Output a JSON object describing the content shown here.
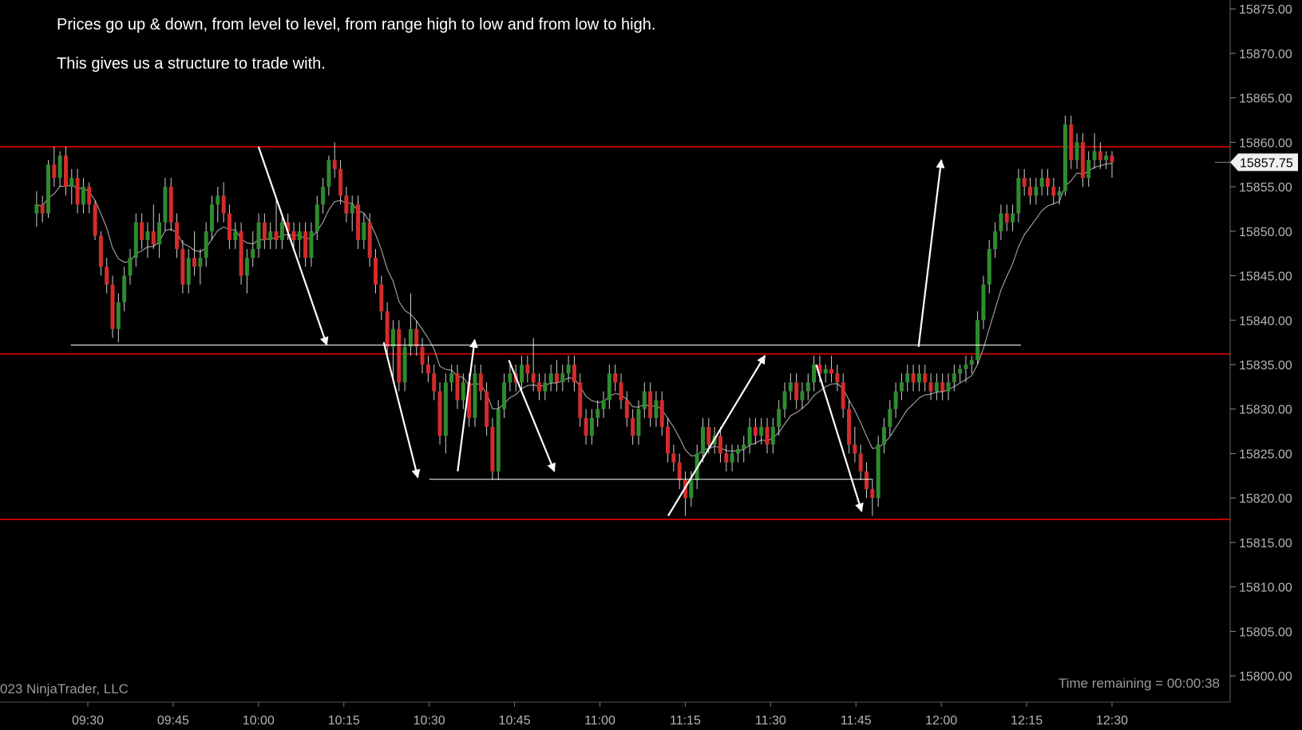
{
  "annotations": {
    "line1": "Prices go up & down, from level to level, from range high to low and from low to high.",
    "line2": "This gives us a structure to trade with."
  },
  "footer": {
    "copyright": "023 NinjaTrader, LLC",
    "time_remaining": "Time remaining = 00:00:38"
  },
  "colors": {
    "background": "#000000",
    "up_candle": "#2e8b2e",
    "down_candle": "#d42b2b",
    "level_line": "#c00000",
    "moving_average": "#9a9a9a",
    "drawing": "#ffffff",
    "axis_text": "#b4b4b4"
  },
  "chart_data": {
    "type": "candlestick",
    "title": "",
    "xlabel": "",
    "ylabel": "",
    "ylim": [
      15797.5,
      15876.0
    ],
    "y_ticks": [
      "15800.00",
      "15805.00",
      "15810.00",
      "15815.00",
      "15820.00",
      "15825.00",
      "15830.00",
      "15835.00",
      "15840.00",
      "15845.00",
      "15850.00",
      "15855.00",
      "15860.00",
      "15865.00",
      "15870.00",
      "15875.00"
    ],
    "x_ticks": [
      "09:30",
      "09:45",
      "10:00",
      "10:15",
      "10:30",
      "10:45",
      "11:00",
      "11:15",
      "11:30",
      "11:45",
      "12:00",
      "12:15",
      "12:30"
    ],
    "x_start": "09:21",
    "x_end": "12:30",
    "last_price": "15857.75",
    "horizontal_levels": [
      15859.5,
      15836.2,
      15817.6
    ],
    "range_lines": [
      {
        "from": "09:27",
        "to": "12:14",
        "price": 15837.2
      },
      {
        "from": "10:30",
        "to": "11:48",
        "price": 15822.1
      }
    ],
    "arrows": [
      {
        "from": [
          "10:00",
          15859.5
        ],
        "to": [
          "10:12",
          15837.2
        ]
      },
      {
        "from": [
          "10:22",
          15837.5
        ],
        "to": [
          "10:28",
          15822.3
        ]
      },
      {
        "from": [
          "10:35",
          15823.0
        ],
        "to": [
          "10:38",
          15837.8
        ]
      },
      {
        "from": [
          "10:44",
          15835.5
        ],
        "to": [
          "10:52",
          15823.0
        ]
      },
      {
        "from": [
          "11:12",
          15818.0
        ],
        "to": [
          "11:29",
          15836.0
        ]
      },
      {
        "from": [
          "11:38",
          15835.0
        ],
        "to": [
          "11:46",
          15818.5
        ]
      },
      {
        "from": [
          "11:56",
          15837.0
        ],
        "to": [
          "12:00",
          15858.0
        ]
      }
    ],
    "candles_ohlc": [
      [
        15852.0,
        15854.5,
        15850.5,
        15853.0
      ],
      [
        15853.0,
        15854.0,
        15851.0,
        15852.0
      ],
      [
        15852.0,
        15858.0,
        15851.5,
        15857.5
      ],
      [
        15857.5,
        15859.5,
        15855.0,
        15856.0
      ],
      [
        15856.0,
        15859.0,
        15855.0,
        15858.5
      ],
      [
        15858.5,
        15859.5,
        15854.0,
        15855.0
      ],
      [
        15855.0,
        15857.0,
        15853.0,
        15856.0
      ],
      [
        15856.0,
        15857.0,
        15852.0,
        15853.0
      ],
      [
        15853.0,
        15856.0,
        15852.0,
        15855.0
      ],
      [
        15855.0,
        15855.5,
        15852.0,
        15853.0
      ],
      [
        15853.0,
        15853.5,
        15849.0,
        15849.5
      ],
      [
        15849.5,
        15850.0,
        15845.0,
        15846.0
      ],
      [
        15846.0,
        15847.0,
        15843.0,
        15844.0
      ],
      [
        15844.0,
        15845.0,
        15838.0,
        15839.0
      ],
      [
        15839.0,
        15843.0,
        15837.5,
        15842.0
      ],
      [
        15842.0,
        15846.0,
        15841.0,
        15845.0
      ],
      [
        15845.0,
        15848.0,
        15844.0,
        15847.0
      ],
      [
        15847.0,
        15852.0,
        15846.0,
        15851.0
      ],
      [
        15851.0,
        15852.0,
        15848.0,
        15849.0
      ],
      [
        15849.0,
        15851.0,
        15847.0,
        15850.0
      ],
      [
        15850.0,
        15853.0,
        15848.0,
        15848.5
      ],
      [
        15848.5,
        15852.0,
        15847.0,
        15851.0
      ],
      [
        15851.0,
        15856.0,
        15850.0,
        15855.0
      ],
      [
        15855.0,
        15856.0,
        15850.0,
        15851.0
      ],
      [
        15851.0,
        15852.0,
        15847.0,
        15848.0
      ],
      [
        15848.0,
        15849.0,
        15843.0,
        15844.0
      ],
      [
        15844.0,
        15848.0,
        15843.0,
        15847.0
      ],
      [
        15847.0,
        15850.0,
        15845.0,
        15846.0
      ],
      [
        15846.0,
        15848.0,
        15844.0,
        15847.0
      ],
      [
        15847.0,
        15851.0,
        15846.0,
        15850.0
      ],
      [
        15850.0,
        15854.0,
        15849.0,
        15853.0
      ],
      [
        15853.0,
        15855.0,
        15851.0,
        15854.0
      ],
      [
        15854.0,
        15855.5,
        15851.0,
        15852.0
      ],
      [
        15852.0,
        15853.0,
        15848.0,
        15849.0
      ],
      [
        15849.0,
        15851.0,
        15848.0,
        15850.0
      ],
      [
        15850.0,
        15851.0,
        15844.0,
        15845.0
      ],
      [
        15845.0,
        15848.0,
        15843.0,
        15847.0
      ],
      [
        15847.0,
        15850.0,
        15846.0,
        15848.0
      ],
      [
        15848.0,
        15852.0,
        15847.0,
        15851.0
      ],
      [
        15851.0,
        15852.0,
        15848.0,
        15849.0
      ],
      [
        15849.0,
        15851.0,
        15848.0,
        15850.0
      ],
      [
        15850.0,
        15854.0,
        15848.0,
        15849.0
      ],
      [
        15849.0,
        15852.0,
        15848.0,
        15851.0
      ],
      [
        15851.0,
        15852.0,
        15849.0,
        15850.0
      ],
      [
        15850.0,
        15851.0,
        15848.0,
        15849.0
      ],
      [
        15849.0,
        15851.0,
        15847.0,
        15850.0
      ],
      [
        15850.0,
        15851.0,
        15846.0,
        15847.0
      ],
      [
        15847.0,
        15851.0,
        15846.0,
        15850.0
      ],
      [
        15850.0,
        15854.0,
        15849.0,
        15853.0
      ],
      [
        15853.0,
        15856.0,
        15852.0,
        15855.0
      ],
      [
        15855.0,
        15858.5,
        15854.0,
        15858.0
      ],
      [
        15858.0,
        15860.0,
        15856.0,
        15857.0
      ],
      [
        15857.0,
        15858.0,
        15853.0,
        15854.0
      ],
      [
        15854.0,
        15855.0,
        15851.0,
        15852.0
      ],
      [
        15852.0,
        15854.0,
        15850.0,
        15853.0
      ],
      [
        15853.0,
        15854.0,
        15848.0,
        15849.0
      ],
      [
        15849.0,
        15852.0,
        15848.0,
        15851.0
      ],
      [
        15851.0,
        15852.0,
        15846.0,
        15847.0
      ],
      [
        15847.0,
        15848.0,
        15843.0,
        15844.0
      ],
      [
        15844.0,
        15845.0,
        15840.0,
        15841.0
      ],
      [
        15841.0,
        15842.0,
        15836.0,
        15837.0
      ],
      [
        15837.0,
        15840.0,
        15833.0,
        15839.0
      ],
      [
        15839.0,
        15840.0,
        15832.0,
        15833.0
      ],
      [
        15833.0,
        15838.0,
        15832.0,
        15837.0
      ],
      [
        15837.0,
        15843.0,
        15836.0,
        15839.0
      ],
      [
        15839.0,
        15840.0,
        15836.0,
        15837.0
      ],
      [
        15837.0,
        15838.0,
        15834.0,
        15835.0
      ],
      [
        15835.0,
        15836.0,
        15833.0,
        15834.0
      ],
      [
        15834.0,
        15835.0,
        15831.0,
        15832.0
      ],
      [
        15832.0,
        15833.0,
        15826.0,
        15827.0
      ],
      [
        15827.0,
        15834.0,
        15825.0,
        15833.0
      ],
      [
        15833.0,
        15835.0,
        15832.0,
        15834.0
      ],
      [
        15834.0,
        15835.0,
        15830.0,
        15831.0
      ],
      [
        15831.0,
        15834.0,
        15830.0,
        15833.0
      ],
      [
        15833.0,
        15834.0,
        15828.0,
        15829.0
      ],
      [
        15829.0,
        15835.0,
        15828.0,
        15834.0
      ],
      [
        15834.0,
        15835.0,
        15831.0,
        15832.0
      ],
      [
        15832.0,
        15833.0,
        15827.0,
        15828.0
      ],
      [
        15828.0,
        15829.0,
        15822.0,
        15823.0
      ],
      [
        15823.0,
        15831.0,
        15822.0,
        15830.0
      ],
      [
        15830.0,
        15834.0,
        15829.0,
        15833.0
      ],
      [
        15833.0,
        15835.0,
        15832.0,
        15834.0
      ],
      [
        15834.0,
        15835.0,
        15832.0,
        15833.0
      ],
      [
        15833.0,
        15836.0,
        15832.0,
        15835.0
      ],
      [
        15835.0,
        15836.0,
        15833.0,
        15834.0
      ],
      [
        15834.0,
        15838.0,
        15832.0,
        15833.0
      ],
      [
        15833.0,
        15834.0,
        15831.0,
        15832.0
      ],
      [
        15832.0,
        15834.0,
        15831.0,
        15833.0
      ],
      [
        15833.0,
        15835.0,
        15832.0,
        15834.0
      ],
      [
        15834.0,
        15835.5,
        15832.0,
        15833.0
      ],
      [
        15833.0,
        15835.0,
        15832.0,
        15834.0
      ],
      [
        15834.0,
        15836.0,
        15833.0,
        15835.0
      ],
      [
        15835.0,
        15836.0,
        15832.0,
        15833.0
      ],
      [
        15833.0,
        15834.0,
        15828.0,
        15829.0
      ],
      [
        15829.0,
        15830.0,
        15826.0,
        15827.0
      ],
      [
        15827.0,
        15830.0,
        15826.0,
        15829.0
      ],
      [
        15829.0,
        15831.0,
        15828.0,
        15830.0
      ],
      [
        15830.0,
        15832.0,
        15829.0,
        15831.0
      ],
      [
        15831.0,
        15835.0,
        15830.0,
        15834.0
      ],
      [
        15834.0,
        15835.0,
        15832.0,
        15833.0
      ],
      [
        15833.0,
        15834.0,
        15830.0,
        15831.0
      ],
      [
        15831.0,
        15832.0,
        15828.0,
        15829.0
      ],
      [
        15829.0,
        15830.0,
        15826.0,
        15827.0
      ],
      [
        15827.0,
        15831.0,
        15826.0,
        15830.0
      ],
      [
        15830.0,
        15833.0,
        15829.0,
        15832.0
      ],
      [
        15832.0,
        15833.0,
        15828.0,
        15829.0
      ],
      [
        15829.0,
        15832.0,
        15828.0,
        15831.0
      ],
      [
        15831.0,
        15832.0,
        15827.0,
        15828.0
      ],
      [
        15828.0,
        15829.0,
        15824.0,
        15825.0
      ],
      [
        15825.0,
        15826.0,
        15823.0,
        15824.0
      ],
      [
        15824.0,
        15825.0,
        15821.0,
        15822.0
      ],
      [
        15822.0,
        15823.0,
        15818.0,
        15820.0
      ],
      [
        15820.0,
        15823.0,
        15819.0,
        15822.0
      ],
      [
        15822.0,
        15826.0,
        15821.0,
        15825.0
      ],
      [
        15825.0,
        15829.0,
        15824.0,
        15828.0
      ],
      [
        15828.0,
        15829.0,
        15825.0,
        15826.0
      ],
      [
        15826.0,
        15828.0,
        15825.0,
        15827.0
      ],
      [
        15827.0,
        15828.0,
        15824.0,
        15825.0
      ],
      [
        15825.0,
        15826.0,
        15823.0,
        15824.0
      ],
      [
        15824.0,
        15826.0,
        15823.0,
        15825.0
      ],
      [
        15825.0,
        15826.0,
        15824.0,
        15825.5
      ],
      [
        15825.5,
        15827.0,
        15824.0,
        15826.0
      ],
      [
        15826.0,
        15829.0,
        15825.0,
        15828.0
      ],
      [
        15828.0,
        15829.0,
        15826.0,
        15827.0
      ],
      [
        15827.0,
        15829.0,
        15826.0,
        15828.0
      ],
      [
        15828.0,
        15829.0,
        15825.0,
        15826.0
      ],
      [
        15826.0,
        15829.0,
        15825.0,
        15828.0
      ],
      [
        15828.0,
        15831.0,
        15827.0,
        15830.0
      ],
      [
        15830.0,
        15833.0,
        15829.0,
        15832.0
      ],
      [
        15832.0,
        15834.0,
        15831.0,
        15833.0
      ],
      [
        15833.0,
        15834.0,
        15830.0,
        15831.0
      ],
      [
        15831.0,
        15833.0,
        15830.0,
        15832.0
      ],
      [
        15832.0,
        15834.0,
        15831.0,
        15833.0
      ],
      [
        15833.0,
        15836.0,
        15832.0,
        15835.0
      ],
      [
        15835.0,
        15836.0,
        15833.0,
        15834.0
      ],
      [
        15834.0,
        15835.0,
        15833.0,
        15834.5
      ],
      [
        15834.5,
        15836.0,
        15833.0,
        15834.0
      ],
      [
        15834.0,
        15835.0,
        15832.0,
        15833.0
      ],
      [
        15833.0,
        15834.0,
        15829.0,
        15830.0
      ],
      [
        15830.0,
        15831.0,
        15825.0,
        15826.0
      ],
      [
        15826.0,
        15828.0,
        15824.0,
        15825.0
      ],
      [
        15825.0,
        15826.0,
        15822.0,
        15823.0
      ],
      [
        15823.0,
        15824.0,
        15820.0,
        15821.0
      ],
      [
        15821.0,
        15822.0,
        15818.0,
        15820.0
      ],
      [
        15820.0,
        15827.0,
        15819.0,
        15826.0
      ],
      [
        15826.0,
        15829.0,
        15825.0,
        15828.0
      ],
      [
        15828.0,
        15831.0,
        15827.0,
        15830.0
      ],
      [
        15830.0,
        15833.0,
        15829.0,
        15832.0
      ],
      [
        15832.0,
        15834.0,
        15831.0,
        15833.0
      ],
      [
        15833.0,
        15835.0,
        15832.0,
        15834.0
      ],
      [
        15834.0,
        15835.0,
        15832.0,
        15833.0
      ],
      [
        15833.0,
        15835.0,
        15832.0,
        15834.0
      ],
      [
        15834.0,
        15835.0,
        15832.0,
        15833.0
      ],
      [
        15833.0,
        15834.0,
        15831.0,
        15832.0
      ],
      [
        15832.0,
        15834.0,
        15831.0,
        15833.0
      ],
      [
        15833.0,
        15834.0,
        15831.0,
        15832.0
      ],
      [
        15832.0,
        15834.0,
        15831.0,
        15833.0
      ],
      [
        15833.0,
        15835.0,
        15832.0,
        15834.0
      ],
      [
        15834.0,
        15835.0,
        15833.0,
        15834.5
      ],
      [
        15834.5,
        15836.0,
        15833.0,
        15835.0
      ],
      [
        15835.0,
        15836.0,
        15834.0,
        15835.5
      ],
      [
        15835.5,
        15841.0,
        15835.0,
        15840.0
      ],
      [
        15840.0,
        15845.0,
        15839.0,
        15844.0
      ],
      [
        15844.0,
        15849.0,
        15843.0,
        15848.0
      ],
      [
        15848.0,
        15851.0,
        15847.0,
        15850.0
      ],
      [
        15850.0,
        15853.0,
        15849.0,
        15852.0
      ],
      [
        15852.0,
        15853.0,
        15850.0,
        15851.0
      ],
      [
        15851.0,
        15853.0,
        15850.0,
        15852.0
      ],
      [
        15852.0,
        15857.0,
        15851.0,
        15856.0
      ],
      [
        15856.0,
        15857.0,
        15854.0,
        15855.0
      ],
      [
        15855.0,
        15856.0,
        15853.0,
        15854.0
      ],
      [
        15854.0,
        15856.0,
        15853.0,
        15855.0
      ],
      [
        15855.0,
        15857.0,
        15854.0,
        15856.0
      ],
      [
        15856.0,
        15857.0,
        15854.0,
        15855.0
      ],
      [
        15855.0,
        15856.0,
        15853.0,
        15854.0
      ],
      [
        15854.0,
        15855.0,
        15853.0,
        15854.5
      ],
      [
        15854.5,
        15863.0,
        15854.0,
        15862.0
      ],
      [
        15862.0,
        15863.0,
        15857.0,
        15858.0
      ],
      [
        15858.0,
        15861.0,
        15857.0,
        15860.0
      ],
      [
        15860.0,
        15861.0,
        15855.0,
        15856.0
      ],
      [
        15856.0,
        15859.0,
        15855.0,
        15858.0
      ],
      [
        15858.0,
        15861.0,
        15857.0,
        15859.0
      ],
      [
        15859.0,
        15860.0,
        15857.0,
        15858.0
      ],
      [
        15858.0,
        15859.0,
        15857.0,
        15858.5
      ],
      [
        15858.5,
        15859.0,
        15856.0,
        15857.75
      ]
    ]
  }
}
